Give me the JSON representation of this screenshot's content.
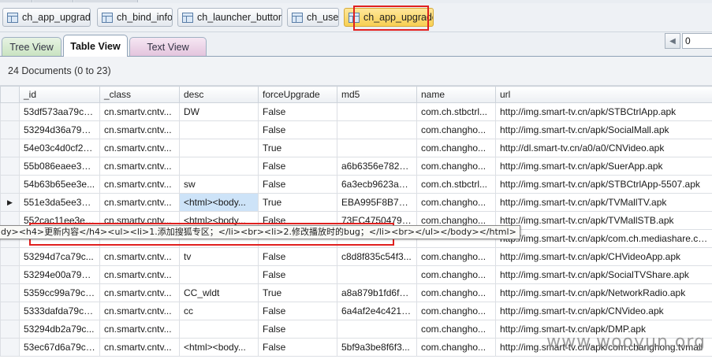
{
  "collection_tabs": [
    {
      "label": "ch_app_upgrade"
    },
    {
      "label": "ch_bind_info"
    },
    {
      "label": "ch_launcher_button"
    },
    {
      "label": "ch_user"
    },
    {
      "label": "ch_app_upgrade"
    }
  ],
  "view_tabs": {
    "tree": "Tree View",
    "table": "Table View",
    "text": "Text View"
  },
  "pager": {
    "prev_icon": "chevron-left-icon",
    "page_value": "0"
  },
  "grid": {
    "group_header": "24 Documents (0 to 23)",
    "columns": [
      "_id",
      "_class",
      "desc",
      "forceUpgrade",
      "md5",
      "name",
      "url"
    ],
    "rows": [
      [
        "53df573aa79c7...",
        "cn.smartv.cntv...",
        "DW",
        "False",
        "",
        "com.ch.stbctrl...",
        "http://img.smart-tv.cn/apk/STBCtrlApp.apk"
      ],
      [
        "53294d36a79c5...",
        "cn.smartv.cntv...",
        "",
        "False",
        "",
        "com.changho...",
        "http://img.smart-tv.cn/apk/SocialMall.apk"
      ],
      [
        "54e03c4d0cf2a...",
        "cn.smartv.cntv...",
        "",
        "True",
        "",
        "com.changho...",
        "http://dl.smart-tv.cn/a0/a0/CNVideo.apk"
      ],
      [
        "55b086eaee3e9...",
        "cn.smartv.cntv...",
        "",
        "False",
        "a6b6356e782b...",
        "com.changho...",
        "http://img.smart-tv.cn/apk/SuerApp.apk"
      ],
      [
        "54b63b65ee3e...",
        "cn.smartv.cntv...",
        "sw",
        "False",
        "6a3ecb9623a62...",
        "com.ch.stbctrl...",
        "http://img.smart-tv.cn/apk/STBCtrlApp-5507.apk"
      ],
      [
        "551e3da5ee3ef...",
        "cn.smartv.cntv...",
        "<html><body...",
        "True",
        "EBA995F8B7FA...",
        "com.changho...",
        "http://img.smart-tv.cn/apk/TVMallTV.apk"
      ],
      [
        "552cac11ee3e8...",
        "cn.smartv.cntv...",
        "<html><body...",
        "False",
        "73EC47504791...",
        "com.changho...",
        "http://img.smart-tv.cn/apk/TVMallSTB.apk"
      ],
      [
        "",
        "",
        "",
        "",
        "",
        "",
        "http://img.smart-tv.cn/apk/com.ch.mediashare.com"
      ],
      [
        "53294d7ca79c...",
        "cn.smartv.cntv...",
        "tv",
        "False",
        "c8d8f835c54f3...",
        "com.changho...",
        "http://img.smart-tv.cn/apk/CHVideoApp.apk"
      ],
      [
        "53294e00a79c9...",
        "cn.smartv.cntv...",
        "",
        "False",
        "",
        "com.changho...",
        "http://img.smart-tv.cn/apk/SocialTVShare.apk"
      ],
      [
        "5359cc99a79c5...",
        "cn.smartv.cntv...",
        "CC_wldt",
        "True",
        "a8a879b1fd6f3...",
        "com.changho...",
        "http://img.smart-tv.cn/apk/NetworkRadio.apk"
      ],
      [
        "5333dafda79c1...",
        "cn.smartv.cntv...",
        "cc",
        "False",
        "6a4af2e4c421d...",
        "com.changho...",
        "http://img.smart-tv.cn/apk/CNVideo.apk"
      ],
      [
        "53294db2a79c...",
        "cn.smartv.cntv...",
        "",
        "False",
        "",
        "com.changho...",
        "http://img.smart-tv.cn/apk/DMP.apk"
      ],
      [
        "53ec67d6a79c4...",
        "cn.smartv.cntv...",
        "<html><body...",
        "False",
        "5bf9a3be8f6f3...",
        "com.changho...",
        "http://img.smart-tv.cn/apk/com.changhong.tvmall"
      ]
    ]
  },
  "tooltip": "dy><h4>更新内容</h4><ul><li>1.添加搜狐专区；</li><br><li>2.修改播放时的bug；</li><br></ul></body></html>",
  "watermark": "www.wooyun.org",
  "colors": {
    "active_tab": "#f7cf52",
    "highlight_box": "#e0201f",
    "selected_cell": "#cde3f8"
  }
}
